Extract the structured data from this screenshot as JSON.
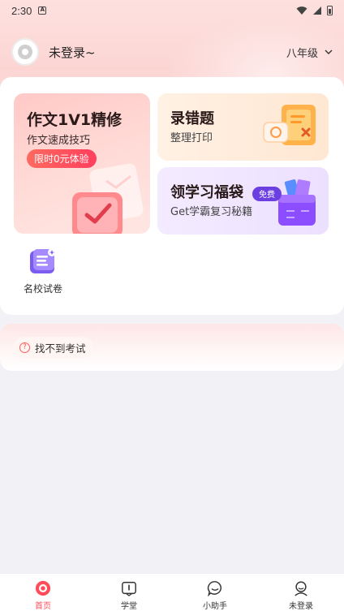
{
  "status_bar": {
    "time": "2:30",
    "a_badge": "A"
  },
  "header": {
    "login_text": "未登录~",
    "grade": "八年级"
  },
  "cards": {
    "essay": {
      "title": "作文1V1精修",
      "subtitle": "作文速成技巧",
      "badge": "限时0元体验"
    },
    "errors": {
      "title": "录错题",
      "subtitle": "整理打印"
    },
    "bag": {
      "title": "领学习福袋",
      "subtitle": "Get学霸复习秘籍",
      "tag": "免费"
    },
    "school": {
      "label": "名校试卷"
    }
  },
  "exam": {
    "label": "找不到考试"
  },
  "nav": [
    {
      "label": "首页",
      "icon": "home-icon",
      "active": true
    },
    {
      "label": "学堂",
      "icon": "book-icon",
      "active": false
    },
    {
      "label": "小助手",
      "icon": "chat-icon",
      "active": false
    },
    {
      "label": "未登录",
      "icon": "profile-icon",
      "active": false
    }
  ],
  "colors": {
    "accent": "#ff4b5a",
    "pill": "#ff3f5e",
    "background": "#f2f2f6"
  }
}
